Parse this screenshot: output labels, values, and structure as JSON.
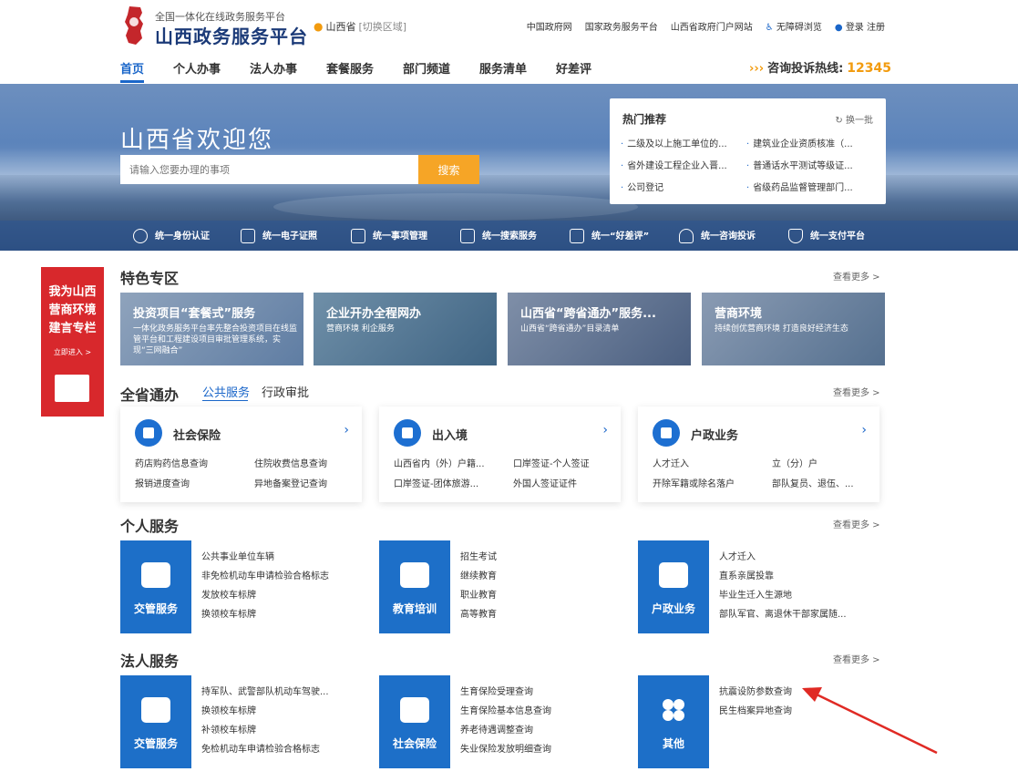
{
  "header": {
    "logo_subtitle": "全国一体化在线政务服务平台",
    "logo_title": "山西政务服务平台",
    "region": "山西省",
    "region_switch": "[切换区域]",
    "top_links": [
      "中国政府网",
      "国家政务服务平台",
      "山西省政府门户网站",
      "无障碍浏览",
      "登录",
      "注册"
    ]
  },
  "nav": {
    "items": [
      "首页",
      "个人办事",
      "法人办事",
      "套餐服务",
      "部门频道",
      "服务清单",
      "好差评"
    ],
    "hotline_label": "咨询投诉热线:",
    "hotline_number": "12345"
  },
  "banner": {
    "welcome": "山西省欢迎您",
    "search_placeholder": "请输入您要办理的事项",
    "search_button": "搜索",
    "hot_title": "热门推荐",
    "hot_refresh": "换一批",
    "hot_items": [
      "二级及以上施工单位的...",
      "建筑业企业资质核准（...",
      "省外建设工程企业入晋...",
      "普通话水平测试等级证...",
      "公司登记",
      "省级药品监督管理部门..."
    ],
    "services": [
      "统一身份认证",
      "统一电子证照",
      "统一事项管理",
      "统一搜索服务",
      "统一“好差评”",
      "统一咨询投诉",
      "统一支付平台"
    ]
  },
  "side_ad": {
    "title_lines": [
      "我为山西",
      "营商环境",
      "建言专栏"
    ],
    "go": "立即进入 >"
  },
  "featured": {
    "title": "特色专区",
    "more": "查看更多 >",
    "items": [
      {
        "title": "投资项目“套餐式”服务",
        "desc": "一体化政务服务平台率先整合投资项目在线监管平台和工程建设项目审批管理系统，实现“三网融合”"
      },
      {
        "title": "企业开办全程网办",
        "desc": "营商环境 利企服务"
      },
      {
        "title": "山西省“跨省通办”服务...",
        "desc": "山西省“跨省通办”目录清单"
      },
      {
        "title": "营商环境",
        "desc": "持续创优营商环境 打造良好经济生态"
      }
    ]
  },
  "province": {
    "title": "全省通办",
    "tabs": [
      "公共服务",
      "行政审批"
    ],
    "more": "查看更多 >",
    "cards": [
      {
        "title": "社会保险",
        "links": [
          "药店购药信息查询",
          "住院收费信息查询",
          "报销进度查询",
          "异地备案登记查询"
        ]
      },
      {
        "title": "出入境",
        "links": [
          "山西省内（外）户籍...",
          "口岸签证-个人签证",
          "口岸签证-团体旅游...",
          "外国人签证证件"
        ]
      },
      {
        "title": "户政业务",
        "links": [
          "人才迁入",
          "立（分）户",
          "开除军籍或除名落户",
          "部队复员、退伍、..."
        ]
      }
    ]
  },
  "personal": {
    "title": "个人服务",
    "more": "查看更多 >",
    "tiles": [
      {
        "label": "交管服务",
        "links": [
          "公共事业单位车辆",
          "非免检机动车申请检验合格标志",
          "发放校车标牌",
          "换领校车标牌"
        ]
      },
      {
        "label": "教育培训",
        "links": [
          "招生考试",
          "继续教育",
          "职业教育",
          "高等教育"
        ]
      },
      {
        "label": "户政业务",
        "links": [
          "人才迁入",
          "直系亲属投靠",
          "毕业生迁入生源地",
          "部队军官、离退休干部家属随..."
        ]
      }
    ]
  },
  "legal": {
    "title": "法人服务",
    "more": "查看更多 >",
    "tiles": [
      {
        "label": "交管服务",
        "links": [
          "持军队、武警部队机动车驾驶...",
          "换领校车标牌",
          "补领校车标牌",
          "免检机动车申请检验合格标志"
        ]
      },
      {
        "label": "社会保险",
        "links": [
          "生育保险受理查询",
          "生育保险基本信息查询",
          "养老待遇调整查询",
          "失业保险发放明细查询"
        ]
      },
      {
        "label": "其他",
        "links": [
          "抗震设防参数查询",
          "民生档案异地查询"
        ]
      }
    ]
  }
}
